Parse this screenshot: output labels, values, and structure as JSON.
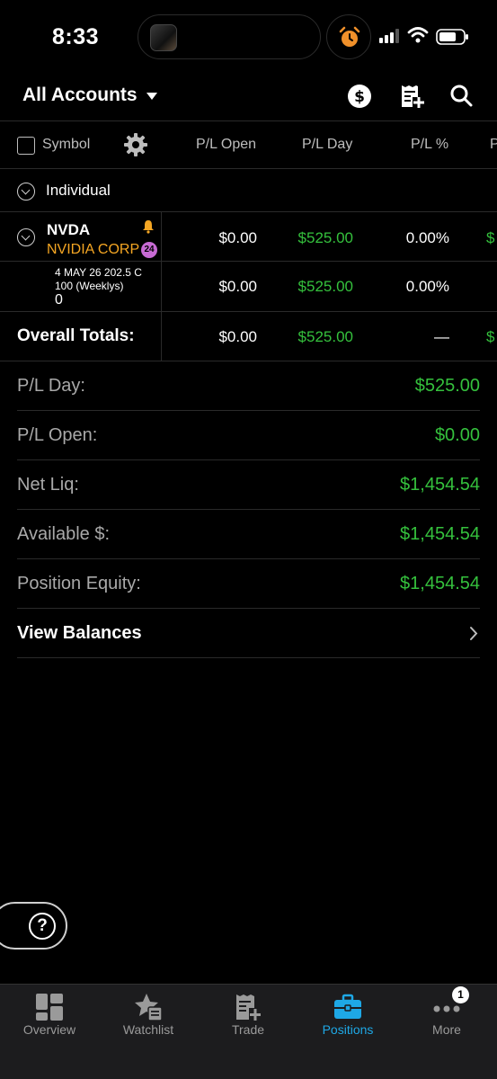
{
  "status_bar": {
    "time": "8:33"
  },
  "header": {
    "account_selector": "All Accounts"
  },
  "columns": {
    "symbol": "Symbol",
    "pl_open": "P/L Open",
    "pl_day": "P/L Day",
    "pl_pct": "P/L %",
    "overflow": "P"
  },
  "group": {
    "name": "Individual"
  },
  "position": {
    "symbol": "NVDA",
    "company": "NVIDIA CORP",
    "badge": "24",
    "pl_open": "$0.00",
    "pl_day": "$525.00",
    "pl_pct": "0.00%",
    "overflow": "$"
  },
  "option_leg": {
    "line1": "4 MAY 26 202.5 C",
    "line2": "100 (Weeklys)",
    "line3": "0",
    "pl_open": "$0.00",
    "pl_day": "$525.00",
    "pl_pct": "0.00%"
  },
  "totals": {
    "label": "Overall Totals:",
    "pl_open": "$0.00",
    "pl_day": "$525.00",
    "pl_pct": "—",
    "overflow": "$"
  },
  "summary": [
    {
      "label": "P/L Day:",
      "value": "$525.00"
    },
    {
      "label": "P/L Open:",
      "value": "$0.00"
    },
    {
      "label": "Net Liq:",
      "value": "$1,454.54"
    },
    {
      "label": "Available $:",
      "value": "$1,454.54"
    },
    {
      "label": "Position Equity:",
      "value": "$1,454.54"
    }
  ],
  "view_balances": "View Balances",
  "help": "?",
  "tabs": [
    {
      "label": "Overview",
      "icon": "grid-icon"
    },
    {
      "label": "Watchlist",
      "icon": "watchlist-star-icon"
    },
    {
      "label": "Trade",
      "icon": "trade-ticket-icon"
    },
    {
      "label": "Positions",
      "icon": "briefcase-icon",
      "active": true
    },
    {
      "label": "More",
      "icon": "more-dots-icon",
      "badge": "1"
    }
  ],
  "colors": {
    "accent": "#1ea8e6",
    "positive": "#35c13d",
    "warning": "#f5a623",
    "company": "#f5a623",
    "badge_purple": "#c76ad3"
  }
}
